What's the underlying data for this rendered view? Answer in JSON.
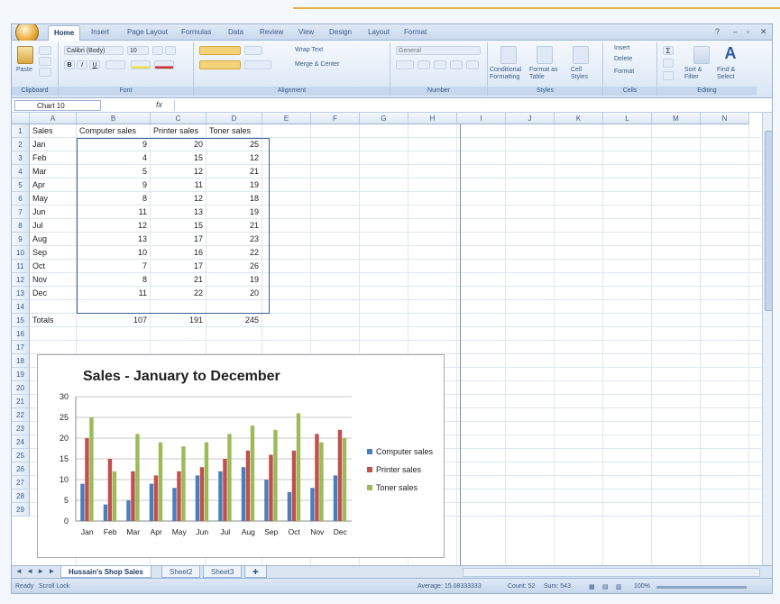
{
  "ribbon": {
    "tabs": [
      "Home",
      "Insert",
      "Page Layout",
      "Formulas",
      "Data",
      "Review",
      "View",
      "Design",
      "Layout",
      "Format"
    ],
    "groups": [
      "Clipboard",
      "Font",
      "Alignment",
      "Number",
      "Styles",
      "Cells",
      "Editing"
    ],
    "paste": "Paste",
    "font_name": "Calibri (Body)",
    "font_size": "10",
    "wrap_text": "Wrap Text",
    "merge_center": "Merge & Center",
    "number_format": "General",
    "conditional_formatting": "Conditional Formatting",
    "format_as_table": "Format as Table",
    "cell_styles": "Cell Styles",
    "insert": "Insert",
    "delete": "Delete",
    "format": "Format",
    "sort_filter": "Sort & Filter",
    "find_select": "Find & Select"
  },
  "formula_bar": {
    "name_box": "Chart 10",
    "fx": "fx"
  },
  "columns": [
    "A",
    "B",
    "C",
    "D",
    "E",
    "F",
    "G",
    "H",
    "I",
    "J",
    "K",
    "L",
    "M",
    "N"
  ],
  "rows": [
    "1",
    "2",
    "3",
    "4",
    "5",
    "6",
    "7",
    "8",
    "9",
    "10",
    "11",
    "12",
    "13",
    "14",
    "15",
    "16",
    "17",
    "18",
    "19",
    "20",
    "21",
    "22",
    "23",
    "24",
    "25",
    "26",
    "27",
    "28",
    "29"
  ],
  "sheet": {
    "headers": [
      "Sales",
      "Computer sales",
      "Printer sales",
      "Toner sales"
    ],
    "data": [
      [
        "Jan",
        "9",
        "20",
        "25"
      ],
      [
        "Feb",
        "4",
        "15",
        "12"
      ],
      [
        "Mar",
        "5",
        "12",
        "21"
      ],
      [
        "Apr",
        "9",
        "11",
        "19"
      ],
      [
        "May",
        "8",
        "12",
        "18"
      ],
      [
        "Jun",
        "11",
        "13",
        "19"
      ],
      [
        "Jul",
        "12",
        "15",
        "21"
      ],
      [
        "Aug",
        "13",
        "17",
        "23"
      ],
      [
        "Sep",
        "10",
        "16",
        "22"
      ],
      [
        "Oct",
        "7",
        "17",
        "26"
      ],
      [
        "Nov",
        "8",
        "21",
        "19"
      ],
      [
        "Dec",
        "11",
        "22",
        "20"
      ]
    ],
    "totals": [
      "Totals",
      "107",
      "191",
      "245"
    ]
  },
  "chart_data": {
    "type": "bar",
    "title": "Sales - January to December",
    "categories": [
      "Jan",
      "Feb",
      "Mar",
      "Apr",
      "May",
      "Jun",
      "Jul",
      "Aug",
      "Sep",
      "Oct",
      "Nov",
      "Dec"
    ],
    "series": [
      {
        "name": "Computer sales",
        "color": "#4a7ebb",
        "values": [
          9,
          4,
          5,
          9,
          8,
          11,
          12,
          13,
          10,
          7,
          8,
          11
        ]
      },
      {
        "name": "Printer sales",
        "color": "#c0504d",
        "values": [
          20,
          15,
          12,
          11,
          12,
          13,
          15,
          17,
          16,
          17,
          21,
          22
        ]
      },
      {
        "name": "Toner sales",
        "color": "#9bbb59",
        "values": [
          25,
          12,
          21,
          19,
          18,
          19,
          21,
          23,
          22,
          26,
          19,
          20
        ]
      }
    ],
    "ylim": [
      0,
      30
    ],
    "yticks": [
      "0",
      "5",
      "10",
      "15",
      "20",
      "25",
      "30"
    ],
    "grid": true,
    "legend": "right"
  },
  "sheet_tabs": [
    "Hussain's Shop Sales",
    "Sheet2",
    "Sheet3"
  ],
  "status": {
    "ready": "Ready",
    "scroll_lock": "Scroll Lock",
    "average": "Average: 15.08333333",
    "count": "Count: 52",
    "sum": "Sum: 543",
    "zoom": "100%"
  },
  "colors": {
    "accent": "#e3b04a",
    "ribbon": "#dfe9f6",
    "selection": "#3a5f9a"
  }
}
